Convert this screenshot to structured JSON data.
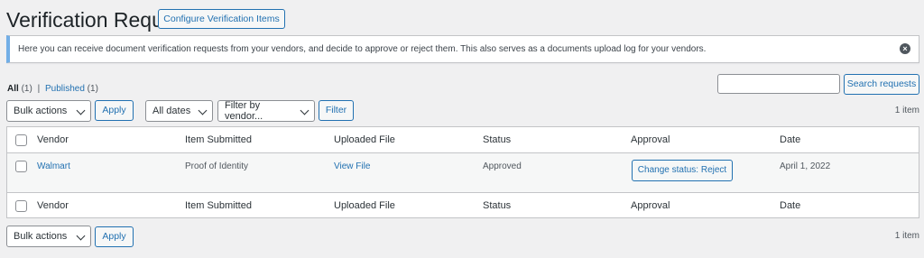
{
  "page": {
    "title": "Verification Requests",
    "configure_button": "Configure Verification Items"
  },
  "notice": {
    "text": "Here you can receive document verification requests from your vendors, and decide to approve or reject them. This also serves as a documents upload log for your vendors.",
    "dismiss_icon": "×"
  },
  "views": {
    "all_label": "All",
    "all_count": "(1)",
    "separator": "|",
    "published_label": "Published",
    "published_count": "(1)"
  },
  "search": {
    "value": "",
    "placeholder": "",
    "button": "Search requests"
  },
  "top_nav": {
    "bulk_actions": "Bulk actions",
    "apply": "Apply",
    "dates": "All dates",
    "vendor_filter": "Filter by vendor...",
    "filter": "Filter",
    "count": "1 item"
  },
  "table": {
    "columns": [
      "Vendor",
      "Item Submitted",
      "Uploaded File",
      "Status",
      "Approval",
      "Date"
    ],
    "rows": [
      {
        "vendor": "Walmart",
        "item": "Proof of Identity",
        "file": "View File",
        "status": "Approved",
        "approval": "Change status: Reject",
        "date": "April 1, 2022"
      }
    ]
  },
  "bottom_nav": {
    "bulk_actions": "Bulk actions",
    "apply": "Apply",
    "count": "1 item"
  }
}
